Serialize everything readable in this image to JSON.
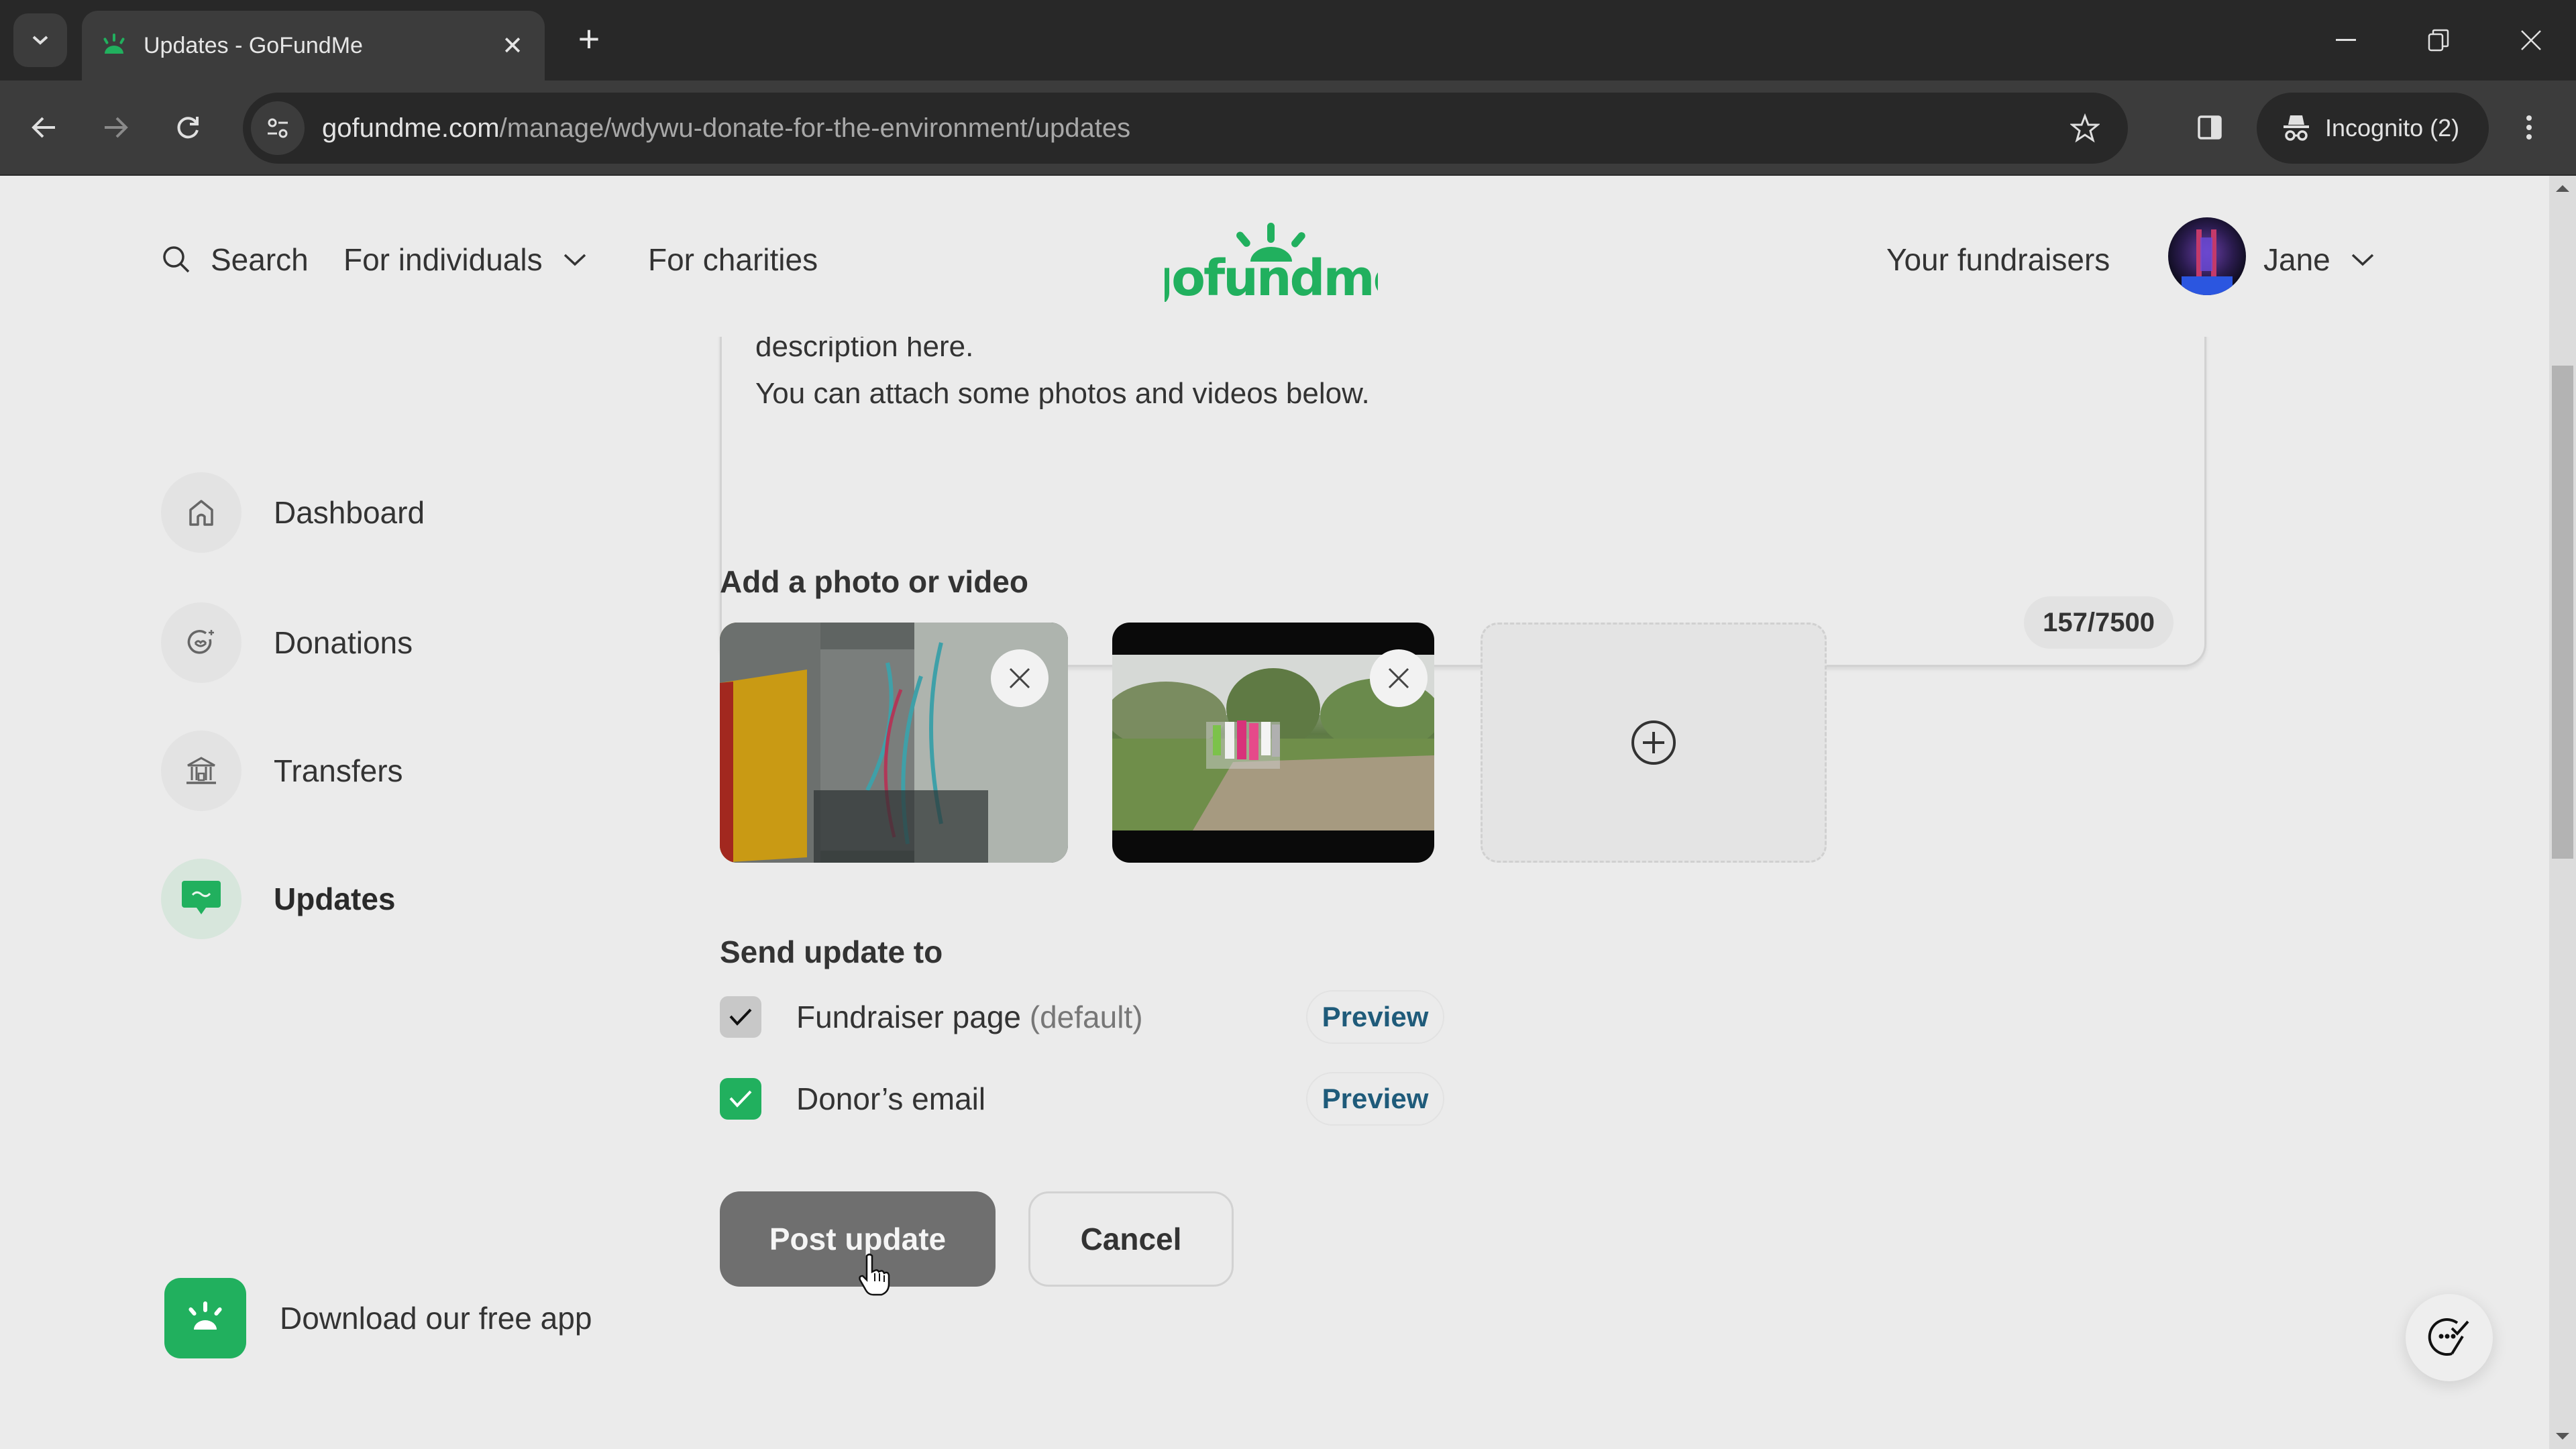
{
  "browser": {
    "tab_title": "Updates - GoFundMe",
    "url_host": "gofundme.com",
    "url_path": "/manage/wdywu-donate-for-the-environment/updates",
    "incognito_label": "Incognito (2)"
  },
  "header": {
    "search_label": "Search",
    "for_individuals_label": "For individuals",
    "for_charities_label": "For charities",
    "logo_text": "gofundme",
    "your_fundraisers_label": "Your fundraisers",
    "user_name": "Jane"
  },
  "sidebar": {
    "items": [
      {
        "label": "Dashboard",
        "icon": "home-icon",
        "active": false
      },
      {
        "label": "Donations",
        "icon": "heart-hand-icon",
        "active": false
      },
      {
        "label": "Transfers",
        "icon": "bank-icon",
        "active": false
      },
      {
        "label": "Updates",
        "icon": "message-icon",
        "active": true
      }
    ],
    "app_promo_label": "Download our free app"
  },
  "editor": {
    "lines": [
      "description here.",
      "You can attach some photos and videos below."
    ],
    "char_count": "157/7500"
  },
  "media": {
    "title": "Add a photo or video",
    "items": [
      {
        "type": "photo",
        "description": "building with colorful streamers"
      },
      {
        "type": "video",
        "description": "group of people in a grassy field"
      }
    ],
    "add_icon": "plus-circle-icon"
  },
  "send_to": {
    "title": "Send update to",
    "options": [
      {
        "label": "Fundraiser page",
        "note": "(default)",
        "checked": true,
        "locked": true,
        "preview_label": "Preview"
      },
      {
        "label": "Donor’s email",
        "note": "",
        "checked": true,
        "locked": false,
        "preview_label": "Preview"
      }
    ]
  },
  "actions": {
    "post_label": "Post update",
    "cancel_label": "Cancel"
  },
  "colors": {
    "brand_green": "#21b05e",
    "preview_link": "#1f5b7a",
    "post_button_disabled": "#6f6f6f"
  }
}
